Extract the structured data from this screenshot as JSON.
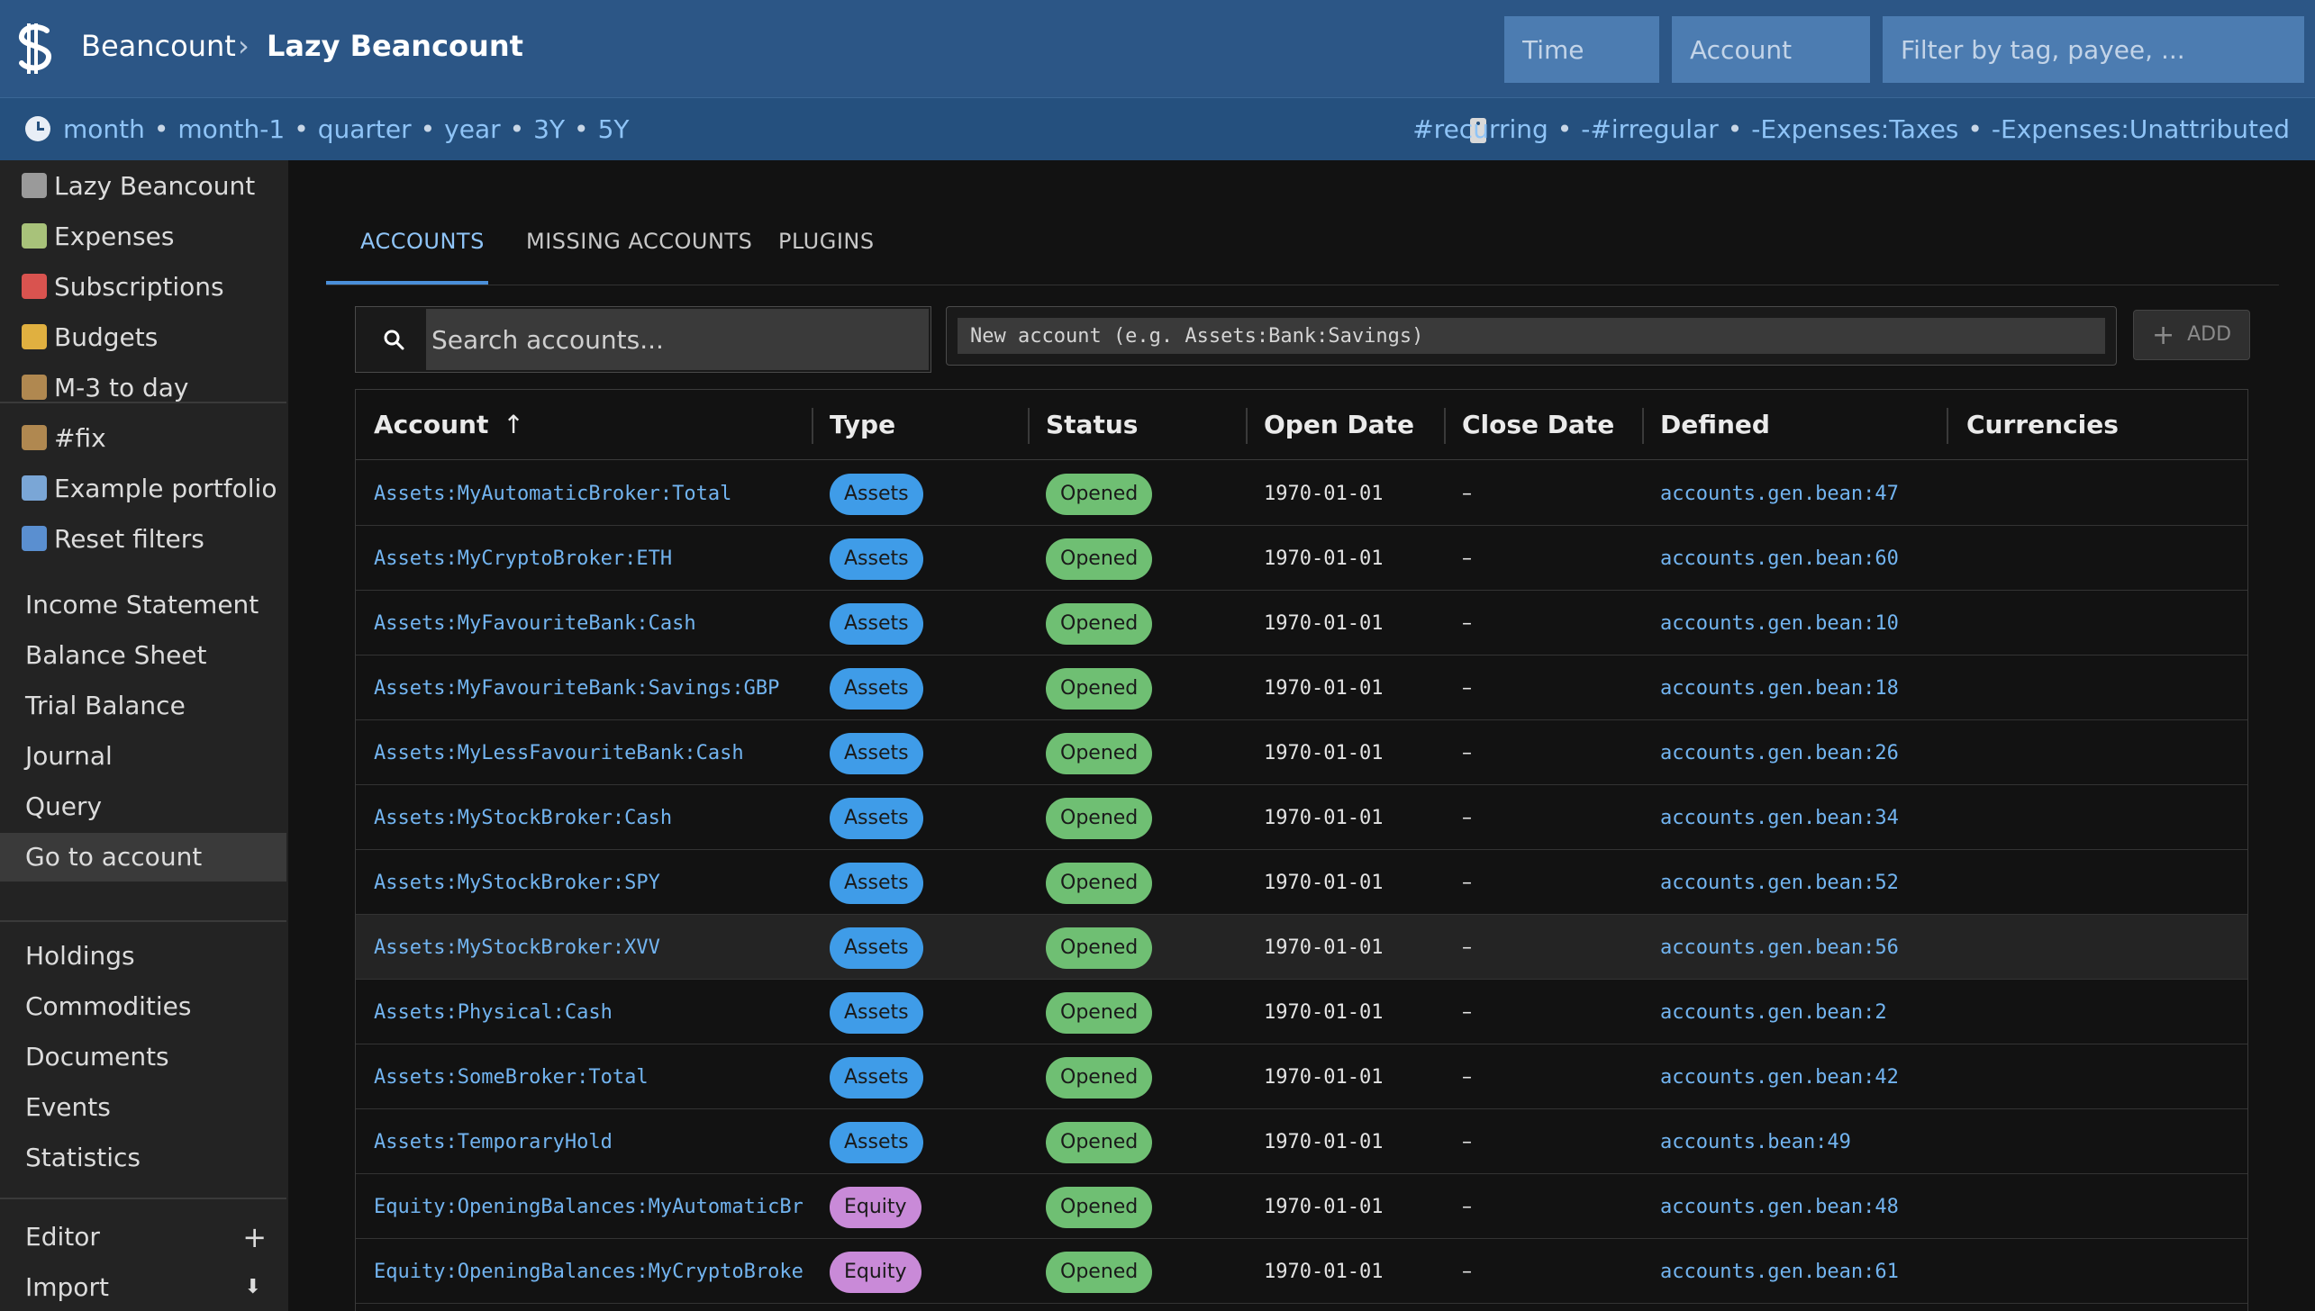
{
  "header": {
    "root": "Beancount",
    "separator": "›",
    "current": "Lazy Beancount",
    "time_placeholder": "Time",
    "account_placeholder": "Account",
    "filter_placeholder": "Filter by tag, payee, ..."
  },
  "time_links": [
    "month",
    "month-1",
    "quarter",
    "year",
    "3Y",
    "5Y"
  ],
  "tag_links": [
    "#recurring",
    "-#irregular",
    "-Expenses:Taxes",
    "-Expenses:Unattributed"
  ],
  "dot": "•",
  "sidebar": {
    "top": [
      {
        "label": "Lazy Beancount",
        "icon": "globe-icon",
        "color": "#9a9a9a"
      },
      {
        "label": "Expenses",
        "icon": "money-icon",
        "color": "#a8c27a"
      },
      {
        "label": "Subscriptions",
        "icon": "calendar-icon",
        "color": "#d9534f"
      },
      {
        "label": "Budgets",
        "icon": "battery-icon",
        "color": "#e0b040"
      },
      {
        "label": "M-3 to day",
        "icon": "ledger-icon",
        "color": "#b08850"
      },
      {
        "label": "#fix",
        "icon": "ledger-icon",
        "color": "#b08850"
      },
      {
        "label": "Example portfolio",
        "icon": "chart-icon",
        "color": "#7aa6d6"
      },
      {
        "label": "Reset filters",
        "icon": "refresh-icon",
        "color": "#5a8fd0"
      }
    ],
    "reports": [
      "Income Statement",
      "Balance Sheet",
      "Trial Balance",
      "Journal",
      "Query",
      "Go to account"
    ],
    "other": [
      "Holdings",
      "Commodities",
      "Documents",
      "Events",
      "Statistics"
    ],
    "tools": [
      {
        "label": "Editor",
        "glyph": "+"
      },
      {
        "label": "Import",
        "glyph": "⬇"
      }
    ]
  },
  "tabs": [
    "ACCOUNTS",
    "MISSING ACCOUNTS",
    "PLUGINS"
  ],
  "search": {
    "placeholder": "Search accounts..."
  },
  "new_account": {
    "placeholder": "New account (e.g. Assets:Bank:Savings)",
    "add_label": "ADD"
  },
  "table": {
    "columns": [
      "Account",
      "Type",
      "Status",
      "Open Date",
      "Close Date",
      "Defined",
      "Currencies"
    ],
    "sort_arrow": "↑",
    "rows": [
      {
        "account": "Assets:MyAutomaticBroker:Total",
        "type": "Assets",
        "status": "Opened",
        "open": "1970-01-01",
        "close": "–",
        "defined": "accounts.gen.bean:47",
        "currencies": ""
      },
      {
        "account": "Assets:MyCryptoBroker:ETH",
        "type": "Assets",
        "status": "Opened",
        "open": "1970-01-01",
        "close": "–",
        "defined": "accounts.gen.bean:60",
        "currencies": ""
      },
      {
        "account": "Assets:MyFavouriteBank:Cash",
        "type": "Assets",
        "status": "Opened",
        "open": "1970-01-01",
        "close": "–",
        "defined": "accounts.gen.bean:10",
        "currencies": ""
      },
      {
        "account": "Assets:MyFavouriteBank:Savings:GBP",
        "type": "Assets",
        "status": "Opened",
        "open": "1970-01-01",
        "close": "–",
        "defined": "accounts.gen.bean:18",
        "currencies": ""
      },
      {
        "account": "Assets:MyLessFavouriteBank:Cash",
        "type": "Assets",
        "status": "Opened",
        "open": "1970-01-01",
        "close": "–",
        "defined": "accounts.gen.bean:26",
        "currencies": ""
      },
      {
        "account": "Assets:MyStockBroker:Cash",
        "type": "Assets",
        "status": "Opened",
        "open": "1970-01-01",
        "close": "–",
        "defined": "accounts.gen.bean:34",
        "currencies": ""
      },
      {
        "account": "Assets:MyStockBroker:SPY",
        "type": "Assets",
        "status": "Opened",
        "open": "1970-01-01",
        "close": "–",
        "defined": "accounts.gen.bean:52",
        "currencies": ""
      },
      {
        "account": "Assets:MyStockBroker:XVV",
        "type": "Assets",
        "status": "Opened",
        "open": "1970-01-01",
        "close": "–",
        "defined": "accounts.gen.bean:56",
        "currencies": "",
        "highlight": true
      },
      {
        "account": "Assets:Physical:Cash",
        "type": "Assets",
        "status": "Opened",
        "open": "1970-01-01",
        "close": "–",
        "defined": "accounts.gen.bean:2",
        "currencies": ""
      },
      {
        "account": "Assets:SomeBroker:Total",
        "type": "Assets",
        "status": "Opened",
        "open": "1970-01-01",
        "close": "–",
        "defined": "accounts.gen.bean:42",
        "currencies": ""
      },
      {
        "account": "Assets:TemporaryHold",
        "type": "Assets",
        "status": "Opened",
        "open": "1970-01-01",
        "close": "–",
        "defined": "accounts.bean:49",
        "currencies": ""
      },
      {
        "account": "Equity:OpeningBalances:MyAutomaticBr",
        "type": "Equity",
        "status": "Opened",
        "open": "1970-01-01",
        "close": "–",
        "defined": "accounts.gen.bean:48",
        "currencies": ""
      },
      {
        "account": "Equity:OpeningBalances:MyCryptoBroke",
        "type": "Equity",
        "status": "Opened",
        "open": "1970-01-01",
        "close": "–",
        "defined": "accounts.gen.bean:61",
        "currencies": ""
      }
    ]
  },
  "colors": {
    "header": "#2c5686",
    "accent": "#4a8fd9",
    "link": "#72b4f0",
    "assets": "#3f9ce8",
    "equity": "#c98ad8",
    "opened": "#6fbf73"
  }
}
